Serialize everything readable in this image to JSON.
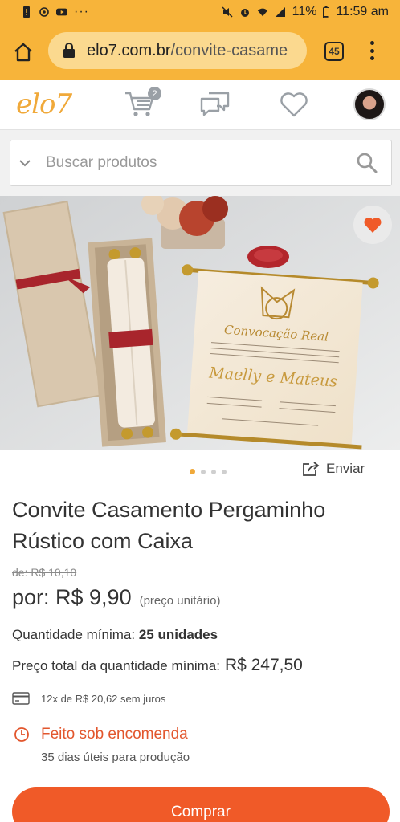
{
  "status_bar": {
    "battery": "11%",
    "time": "11:59 am"
  },
  "browser": {
    "url_domain": "elo7.com.br",
    "url_path": "/convite-casame",
    "tabs_count": "45"
  },
  "header": {
    "logo": "elo7",
    "cart_count": "2"
  },
  "search": {
    "placeholder": "Buscar produtos"
  },
  "colors": {
    "brand_orange": "#f05a28",
    "chrome_orange": "#f7b43a",
    "logo": "#f0a93a",
    "alert": "#e2562d"
  },
  "carousel": {
    "dot_count": 4,
    "active_index": 0
  },
  "share_label": "Enviar",
  "product": {
    "title": "Convite Casamento Pergaminho Rústico com Caixa",
    "old_price": "de: R$ 10,10",
    "price": "por: R$ 9,90",
    "unit_note": "(preço unitário)",
    "min_qty_label": "Quantidade mínima:",
    "min_qty_value": "25 unidades",
    "total_label": "Preço total da quantidade mínima:",
    "total_value": "R$ 247,50",
    "installment": "12x de R$ 20,62 sem juros",
    "made_to_order": "Feito sob encomenda",
    "lead_time": "35 dias úteis para produção"
  },
  "buy_label": "Comprar",
  "invitation_text": {
    "heading": "Convocação Real",
    "names": "Maelly e Mateus"
  }
}
